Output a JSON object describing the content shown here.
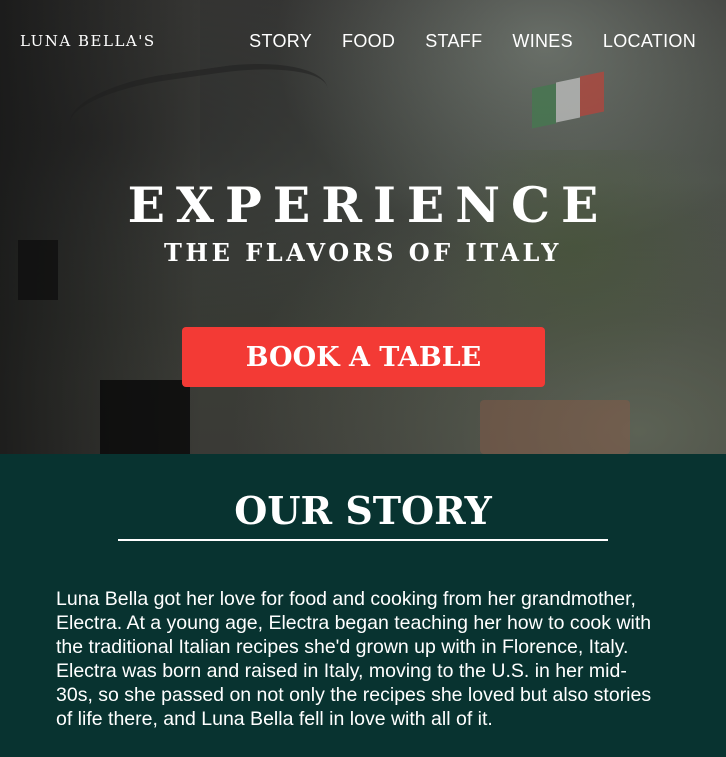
{
  "nav": {
    "brand": "LUNA BELLA'S",
    "items": [
      {
        "label": "STORY"
      },
      {
        "label": "FOOD"
      },
      {
        "label": "STAFF"
      },
      {
        "label": "WINES"
      },
      {
        "label": "LOCATION"
      }
    ]
  },
  "hero": {
    "headline": "EXPERIENCE",
    "subheadline": "THE FLAVORS OF ITALY",
    "cta_label": "BOOK A TABLE"
  },
  "story": {
    "title": "OUR STORY",
    "body": "Luna Bella got her love for food and cooking from her grandmother, Electra. At a young age, Electra began teaching her how to cook with the traditional Italian recipes she'd grown up with in Florence, Italy. Electra was born and raised in Italy, moving to the U.S. in her mid-30s, so she passed on not only the recipes she loved but also stories of life there, and Luna Bella fell in love with all of it."
  },
  "colors": {
    "accent": "#f33a35",
    "story_background": "#083330"
  }
}
